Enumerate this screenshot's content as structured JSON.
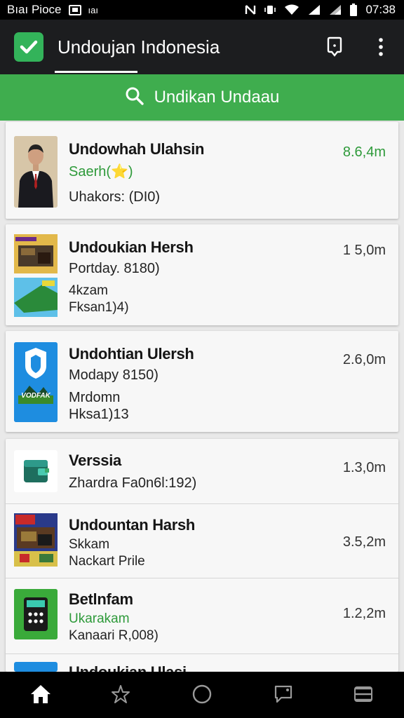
{
  "status_bar": {
    "left_text": "Bıaı Pioce",
    "extra_text": "ıaı",
    "time": "07:38"
  },
  "app_bar": {
    "title": "Undoujan Indonesia",
    "logo_icon": "check-icon",
    "colors": {
      "bar": "#1c1d1f",
      "logo": "#33b35a"
    }
  },
  "search": {
    "label": "Undikan Undaau",
    "color": "#3fad4e"
  },
  "items": [
    {
      "name": "Undowhah Ulahsin",
      "lines": [
        "Saerh(⭐)",
        "Uhakors: (DI0)"
      ],
      "size": "8.6,4m",
      "size_color": "#2e9a3a",
      "thumb": "person-photo"
    },
    {
      "name": "Undoukian Hersh",
      "lines": [
        "Portday. 8180)",
        "4kzam",
        "Fksan1)4)"
      ],
      "size": "1 5,0m",
      "thumb": "game-collage"
    },
    {
      "name": "Undohtian Ulersh",
      "lines": [
        "Modapy 8150)",
        "Mrdomn",
        "Hksa1)13"
      ],
      "size": "2.6,0m",
      "thumb": "shield-logo",
      "thumb_text": "VODFAK"
    },
    {
      "name": "Verssia",
      "lines": [
        "Zhardra Fa0n6l:192)"
      ],
      "size": "1.3,0m",
      "thumb": "wallet-app-icon"
    },
    {
      "name": "Undountan Harsh",
      "lines": [
        "Skkam",
        "Nackart Prile"
      ],
      "size": "3.5,2m",
      "thumb": "game-collage-2"
    },
    {
      "name": "Betlnfam",
      "lines": [
        "Ukarakam",
        "Kanaari R,008)"
      ],
      "size": "1.2,2m",
      "thumb": "calculator-app-icon"
    },
    {
      "name": "Undoukian Ulasi",
      "lines": [],
      "size": "",
      "thumb": "app-icon-partial"
    }
  ],
  "bottom_nav": [
    "home-icon",
    "favorites-icon",
    "circle-icon",
    "messages-icon",
    "menu-icon"
  ]
}
